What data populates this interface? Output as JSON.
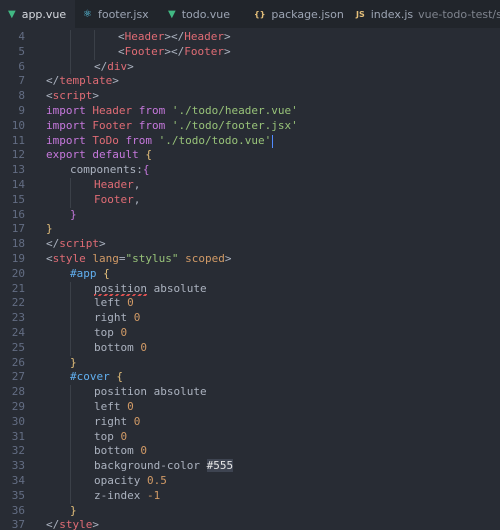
{
  "colors": {
    "background": "#282c34",
    "tab_bar": "#21252b",
    "tag": "#e06c75",
    "keyword": "#c678dd",
    "string": "#98c379",
    "number": "#d19a66",
    "selector": "#61afef",
    "attr": "#d19a66",
    "punct": "#abb2bf",
    "bracket": "#e5c07b"
  },
  "tabs": [
    {
      "label": "app.vue",
      "icon": "vue-file-icon",
      "icon_glyph": "▼",
      "icon_color": "#41b883",
      "active": true,
      "modified": true
    },
    {
      "label": "footer.jsx",
      "icon": "react-file-icon",
      "icon_glyph": "⚛",
      "icon_color": "#61dafb"
    },
    {
      "label": "todo.vue",
      "icon": "vue-file-icon",
      "icon_glyph": "▼",
      "icon_color": "#41b883"
    },
    {
      "label": "package.json",
      "icon": "json-file-icon",
      "icon_glyph": "{}",
      "icon_color": "#e5c07b"
    },
    {
      "label": "index.js",
      "icon": "js-file-icon",
      "icon_glyph": "JS",
      "icon_color": "#e5c07b",
      "path": "vue-todo-test/src"
    }
  ],
  "lines": [
    {
      "n": "4",
      "indent": 3,
      "tokens": [
        [
          "<",
          "p"
        ],
        [
          "Header",
          "t"
        ],
        [
          "></",
          "p"
        ],
        [
          "Header",
          "t"
        ],
        [
          ">",
          "p"
        ]
      ]
    },
    {
      "n": "5",
      "indent": 3,
      "tokens": [
        [
          "<",
          "p"
        ],
        [
          "Footer",
          "t"
        ],
        [
          "></",
          "p"
        ],
        [
          "Footer",
          "t"
        ],
        [
          ">",
          "p"
        ]
      ]
    },
    {
      "n": "6",
      "indent": 2,
      "tokens": [
        [
          "</",
          "p"
        ],
        [
          "div",
          "t"
        ],
        [
          ">",
          "p"
        ]
      ]
    },
    {
      "n": "7",
      "indent": 0,
      "tokens": [
        [
          "</",
          "p"
        ],
        [
          "template",
          "t"
        ],
        [
          ">",
          "p"
        ]
      ]
    },
    {
      "n": "8",
      "indent": 0,
      "tokens": [
        [
          "<",
          "p"
        ],
        [
          "script",
          "t"
        ],
        [
          ">",
          "p"
        ]
      ]
    },
    {
      "n": "9",
      "indent": 0,
      "tokens": [
        [
          "import",
          "k"
        ],
        [
          " Header ",
          "t"
        ],
        [
          "from",
          "k"
        ],
        [
          " ",
          "p"
        ],
        [
          "'./todo/header.vue'",
          "s"
        ]
      ]
    },
    {
      "n": "10",
      "indent": 0,
      "tokens": [
        [
          "import",
          "k"
        ],
        [
          " Footer ",
          "t"
        ],
        [
          "from",
          "k"
        ],
        [
          " ",
          "p"
        ],
        [
          "'./todo/footer.jsx'",
          "s"
        ]
      ]
    },
    {
      "n": "11",
      "indent": 0,
      "tokens": [
        [
          "import",
          "k"
        ],
        [
          " ToDo ",
          "t"
        ],
        [
          "from",
          "k"
        ],
        [
          " ",
          "p"
        ],
        [
          "'./todo/todo.vue'",
          "s"
        ]
      ]
    },
    {
      "n": "12",
      "indent": 0,
      "tokens": [
        [
          "export",
          "k"
        ],
        [
          " ",
          "p"
        ],
        [
          "default",
          "k"
        ],
        [
          " ",
          "p"
        ],
        [
          "{",
          "b"
        ]
      ]
    },
    {
      "n": "13",
      "indent": 1,
      "tokens": [
        [
          "components",
          "p"
        ],
        [
          ":",
          "p"
        ],
        [
          "{",
          "b2"
        ]
      ]
    },
    {
      "n": "14",
      "indent": 2,
      "tokens": [
        [
          "Header",
          "t"
        ],
        [
          ",",
          "p"
        ]
      ]
    },
    {
      "n": "15",
      "indent": 2,
      "tokens": [
        [
          "Footer",
          "t"
        ],
        [
          ",",
          "p"
        ]
      ]
    },
    {
      "n": "16",
      "indent": 1,
      "tokens": [
        [
          "}",
          "b2"
        ]
      ]
    },
    {
      "n": "17",
      "indent": 0,
      "tokens": [
        [
          "}",
          "b"
        ]
      ]
    },
    {
      "n": "18",
      "indent": 0,
      "tokens": [
        [
          "</",
          "p"
        ],
        [
          "script",
          "t"
        ],
        [
          ">",
          "p"
        ]
      ]
    },
    {
      "n": "19",
      "indent": 0,
      "tokens": [
        [
          "<",
          "p"
        ],
        [
          "style",
          "t"
        ],
        [
          " ",
          "p"
        ],
        [
          "lang",
          "a"
        ],
        [
          "=",
          "p"
        ],
        [
          "\"stylus\"",
          "s"
        ],
        [
          " ",
          "p"
        ],
        [
          "scoped",
          "a"
        ],
        [
          ">",
          "p"
        ]
      ]
    },
    {
      "n": "20",
      "indent": 1,
      "tokens": [
        [
          "#app",
          "sel"
        ],
        [
          " ",
          "p"
        ],
        [
          "{",
          "b"
        ]
      ]
    },
    {
      "n": "21",
      "indent": 2,
      "tokens": [
        [
          "position",
          "p"
        ],
        [
          " absolute",
          "p"
        ]
      ]
    },
    {
      "n": "22",
      "indent": 2,
      "tokens": [
        [
          "left",
          "p"
        ],
        [
          " ",
          "p"
        ],
        [
          "0",
          "num"
        ]
      ]
    },
    {
      "n": "23",
      "indent": 2,
      "tokens": [
        [
          "right",
          "p"
        ],
        [
          " ",
          "p"
        ],
        [
          "0",
          "num"
        ]
      ]
    },
    {
      "n": "24",
      "indent": 2,
      "tokens": [
        [
          "top",
          "p"
        ],
        [
          " ",
          "p"
        ],
        [
          "0",
          "num"
        ]
      ]
    },
    {
      "n": "25",
      "indent": 2,
      "tokens": [
        [
          "bottom",
          "p"
        ],
        [
          " ",
          "p"
        ],
        [
          "0",
          "num"
        ]
      ]
    },
    {
      "n": "26",
      "indent": 1,
      "tokens": [
        [
          "}",
          "b"
        ]
      ]
    },
    {
      "n": "27",
      "indent": 1,
      "tokens": [
        [
          "#cover",
          "sel"
        ],
        [
          " ",
          "p"
        ],
        [
          "{",
          "b"
        ]
      ]
    },
    {
      "n": "28",
      "indent": 2,
      "tokens": [
        [
          "position",
          "p"
        ],
        [
          " absolute",
          "p"
        ]
      ]
    },
    {
      "n": "29",
      "indent": 2,
      "tokens": [
        [
          "left",
          "p"
        ],
        [
          " ",
          "p"
        ],
        [
          "0",
          "num"
        ]
      ]
    },
    {
      "n": "30",
      "indent": 2,
      "tokens": [
        [
          "right",
          "p"
        ],
        [
          " ",
          "p"
        ],
        [
          "0",
          "num"
        ]
      ]
    },
    {
      "n": "31",
      "indent": 2,
      "tokens": [
        [
          "top",
          "p"
        ],
        [
          " ",
          "p"
        ],
        [
          "0",
          "num"
        ]
      ]
    },
    {
      "n": "32",
      "indent": 2,
      "tokens": [
        [
          "bottom",
          "p"
        ],
        [
          " ",
          "p"
        ],
        [
          "0",
          "num"
        ]
      ]
    },
    {
      "n": "33",
      "indent": 2,
      "tokens": [
        [
          "background-color",
          "p"
        ],
        [
          " ",
          "p"
        ],
        [
          "#555",
          "hl"
        ]
      ]
    },
    {
      "n": "34",
      "indent": 2,
      "tokens": [
        [
          "opacity",
          "p"
        ],
        [
          " ",
          "p"
        ],
        [
          "0.5",
          "num"
        ]
      ]
    },
    {
      "n": "35",
      "indent": 2,
      "tokens": [
        [
          "z-index",
          "p"
        ],
        [
          " ",
          "p"
        ],
        [
          "-1",
          "num"
        ]
      ]
    },
    {
      "n": "36",
      "indent": 1,
      "tokens": [
        [
          "}",
          "b"
        ]
      ]
    },
    {
      "n": "37",
      "indent": 0,
      "tokens": [
        [
          "</",
          "p"
        ],
        [
          "style",
          "t"
        ],
        [
          ">",
          "p"
        ]
      ]
    }
  ]
}
